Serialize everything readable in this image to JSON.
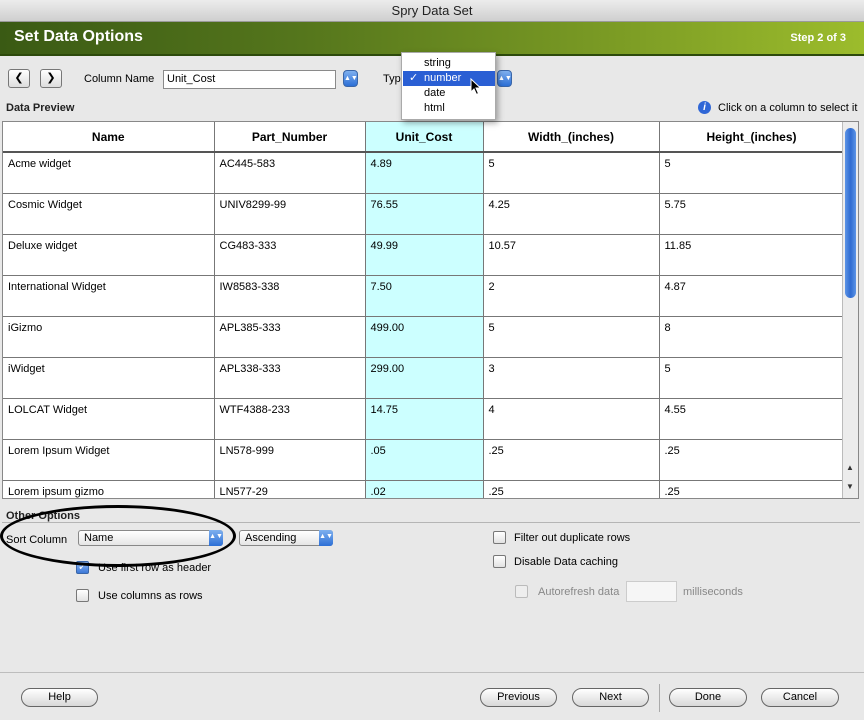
{
  "window": {
    "title": "Spry Data Set"
  },
  "banner": {
    "title": "Set Data Options",
    "step": "Step 2 of 3"
  },
  "nav": {
    "prev_glyph": "❮",
    "next_glyph": "❯"
  },
  "column": {
    "label": "Column Name",
    "value": "Unit_Cost",
    "type_label": "Type"
  },
  "type_menu": {
    "options": [
      "string",
      "number",
      "date",
      "html"
    ],
    "selected": "number",
    "check": "✓"
  },
  "preview": {
    "label": "Data Preview",
    "hint": "Click on a column to select it",
    "info_glyph": "i"
  },
  "table": {
    "headers": [
      "Name",
      "Part_Number",
      "Unit_Cost",
      "Width_(inches)",
      "Height_(inches)"
    ],
    "highlighted_column": 2,
    "rows": [
      [
        "Acme widget",
        "AC445-583",
        "4.89",
        "5",
        "5"
      ],
      [
        "Cosmic Widget",
        "UNIV8299-99",
        "76.55",
        "4.25",
        "5.75"
      ],
      [
        "Deluxe widget",
        "CG483-333",
        "49.99",
        "10.57",
        "11.85"
      ],
      [
        "International Widget",
        "IW8583-338",
        "7.50",
        "2",
        "4.87"
      ],
      [
        "iGizmo",
        "APL385-333",
        "499.00",
        "5",
        "8"
      ],
      [
        "iWidget",
        "APL338-333",
        "299.00",
        "3",
        "5"
      ],
      [
        "LOLCAT Widget",
        "WTF4388-233",
        "14.75",
        "4",
        "4.55"
      ],
      [
        "Lorem Ipsum Widget",
        "LN578-999",
        ".05",
        ".25",
        ".25"
      ],
      [
        "Lorem ipsum gizmo",
        "LN577-29",
        ".02",
        ".25",
        ".25"
      ]
    ]
  },
  "options": {
    "section_label": "Other Options",
    "sort_label": "Sort Column",
    "sort_value": "Name",
    "order_value": "Ascending",
    "first_row_header": {
      "label": "Use first row as header",
      "checked": true
    },
    "columns_as_rows": {
      "label": "Use columns as rows",
      "checked": false
    },
    "filter_duplicates": {
      "label": "Filter out duplicate rows",
      "checked": false
    },
    "disable_caching": {
      "label": "Disable Data caching",
      "checked": false
    },
    "autorefresh": {
      "label": "Autorefresh data",
      "unit": "milliseconds",
      "value": ""
    }
  },
  "buttons": {
    "help": "Help",
    "previous": "Previous",
    "next": "Next",
    "done": "Done",
    "cancel": "Cancel"
  },
  "colors": {
    "highlight": "#ccffff",
    "banner": "#55761c",
    "selection": "#2a5fd4"
  }
}
